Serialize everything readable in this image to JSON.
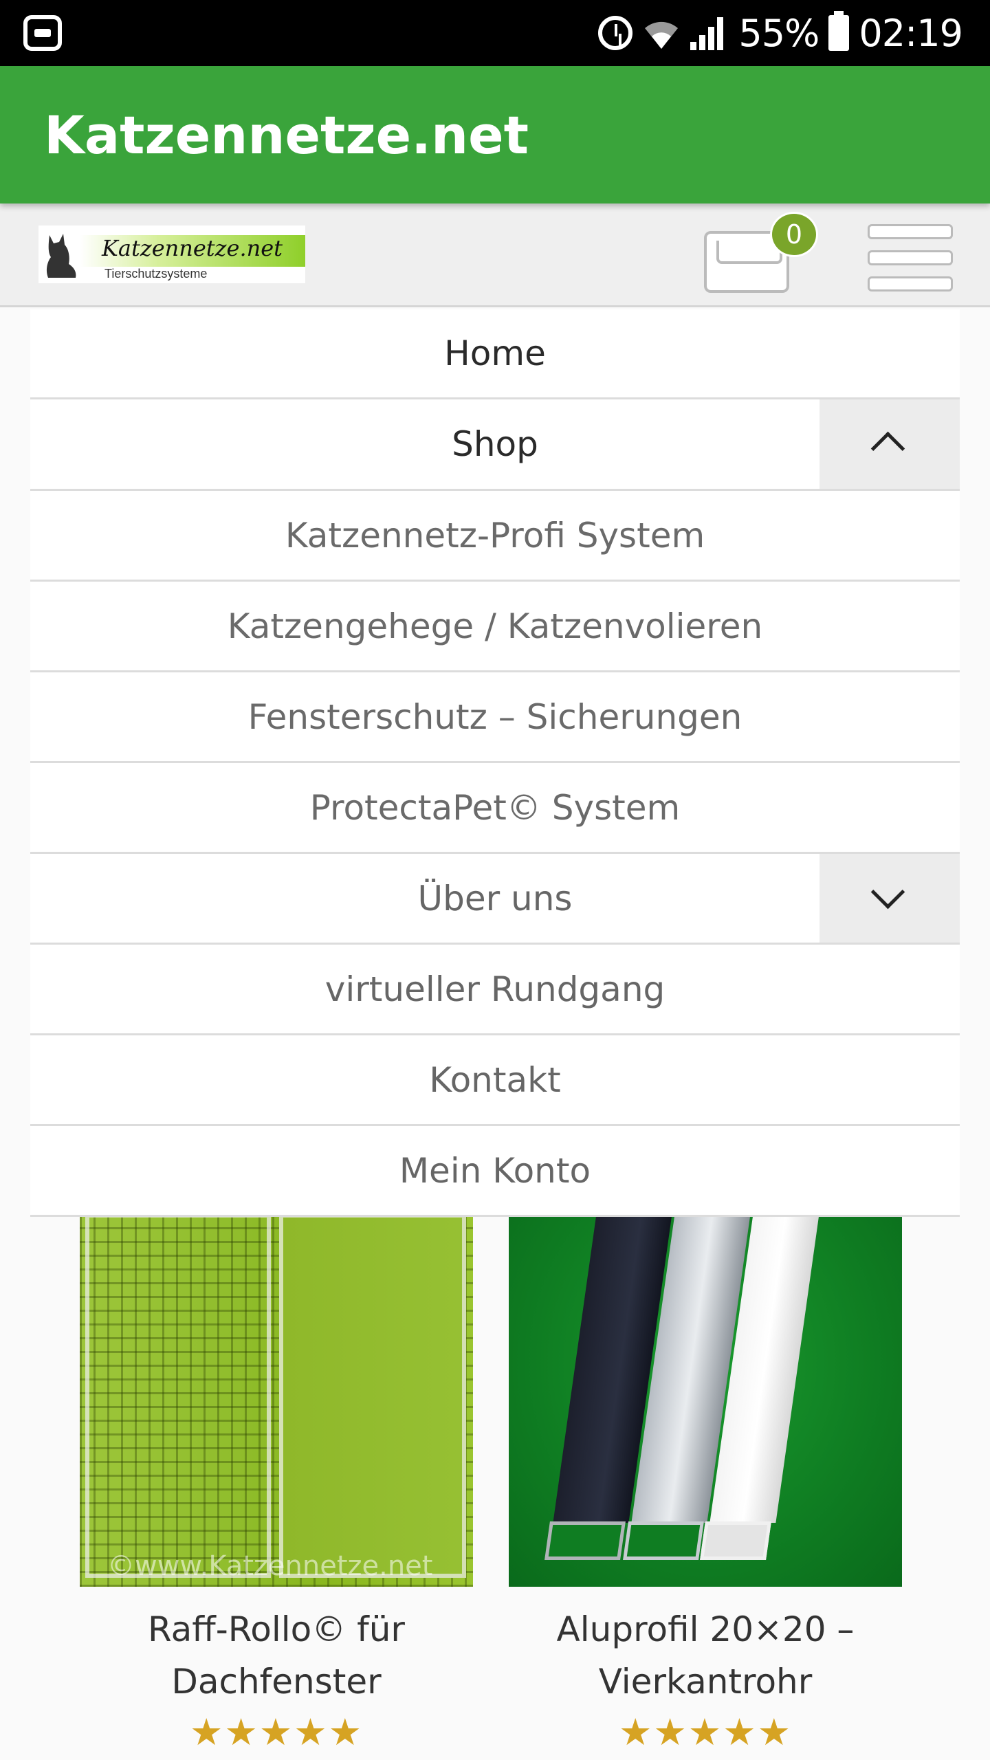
{
  "status_bar": {
    "battery_percent": "55%",
    "time": "02:19",
    "icons": [
      "app-icon",
      "alarm-icon",
      "wifi-icon",
      "signal-icon",
      "battery-charging-icon"
    ]
  },
  "app_bar": {
    "title": "Katzennetze.net"
  },
  "header": {
    "logo_text": "Katzennetze.net",
    "logo_subtext": "Tierschutzsysteme",
    "cart_count": "0"
  },
  "menu": {
    "items": [
      {
        "label": "Home"
      },
      {
        "label": "Shop"
      },
      {
        "label": "Katzennetz-Profi System"
      },
      {
        "label": "Katzengehege / Katzenvolieren"
      },
      {
        "label": "Fensterschutz – Sicherungen"
      },
      {
        "label": "ProtectaPet© System"
      },
      {
        "label": "Über uns"
      },
      {
        "label": "virtueller Rundgang"
      },
      {
        "label": "Kontakt"
      },
      {
        "label": "Mein Konto"
      }
    ]
  },
  "products": [
    {
      "title": "Raff-Rollo© für Dachfenster",
      "watermark": "©www.Katzennetze.net",
      "rating": "★★★★★"
    },
    {
      "title": "Aluprofil 20×20 – Vierkantrohr",
      "rating": "★★★★★"
    }
  ],
  "colors": {
    "app_bar": "#3aa43b",
    "badge": "#7aa52a",
    "stars": "#d6a323"
  }
}
